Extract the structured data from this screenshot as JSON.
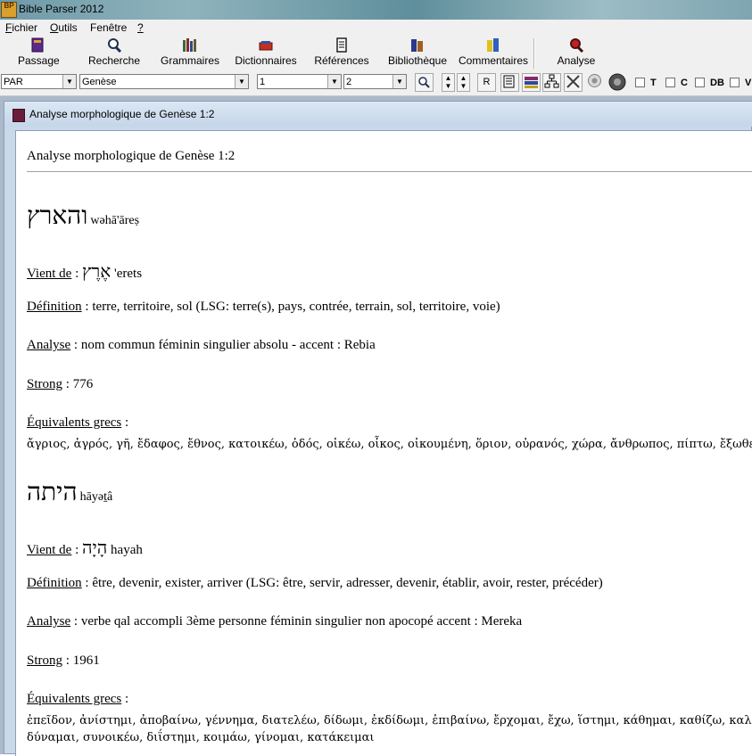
{
  "window": {
    "title": "Bible Parser 2012",
    "app_badge": "BP"
  },
  "menu": [
    {
      "label": "Fichier",
      "accel": "F",
      "rest": "ichier"
    },
    {
      "label": "Outils",
      "accel": "O",
      "rest": "utils"
    },
    {
      "label": "Fenêtre",
      "accel": "Fen",
      "rest": "être",
      "accel_pos": "n"
    },
    {
      "label": "?",
      "accel": "?",
      "rest": ""
    }
  ],
  "toolbar": {
    "buttons": [
      {
        "label": "Passage",
        "icon": "book-icon"
      },
      {
        "label": "Recherche",
        "icon": "magnifier-icon"
      },
      {
        "label": "Grammaires",
        "icon": "books-icon"
      },
      {
        "label": "Dictionnaires",
        "icon": "dictionary-icon"
      },
      {
        "label": "Références",
        "icon": "document-icon"
      },
      {
        "label": "Bibliothèque",
        "icon": "library-icon"
      },
      {
        "label": "Commentaires",
        "icon": "comments-icon"
      },
      {
        "label": "Analyse",
        "icon": "analysis-icon"
      }
    ]
  },
  "selectors": {
    "version": "PAR",
    "book": "Genèse",
    "chapter": "1",
    "verse": "2",
    "r_button": "R",
    "checkboxes": [
      "T",
      "C",
      "DB",
      "V"
    ]
  },
  "child_window": {
    "title": "Analyse morphologique de Genèse 1:2"
  },
  "content": {
    "heading": "Analyse morphologique de Genèse 1:2",
    "labels": {
      "vient_de": "Vient de",
      "definition": "Définition",
      "analyse": "Analyse",
      "strong": "Strong",
      "equivalents": "Équivalents grecs"
    },
    "entries": [
      {
        "word": "והארץ",
        "translit": "wəhā'āreṣ",
        "root_hebrew": "אֶרֶץ",
        "root_translit": "'erets",
        "definition": "terre, territoire, sol (LSG: terre(s), pays, contrée, terrain, sol, territoire, voie)",
        "analyse": "nom commun féminin singulier absolu - accent : Rebia",
        "strong": "776",
        "greek": "ἄγριος, ἀγρός, γῆ, ἔδαφος, ἔθνος, κατοικέω, ὁδός, οἰκέω, οἶκος, οἰκουμένη, ὅριον, οὐρανός, χώρα, ἄνθρωπος, πίπτω, ἔξωθεν"
      },
      {
        "word": "היתה",
        "translit": "hāyəṯâ",
        "root_hebrew": "הָיָה",
        "root_translit": "hayah",
        "definition": "être, devenir, exister, arriver (LSG: être, servir, adresser, devenir, établir, avoir, rester, précéder)",
        "analyse": "verbe qal accompli 3ème personne féminin singulier non apocopé accent : Mereka",
        "strong": "1961",
        "greek": "ἐπεῖδον, ἀνίστημι, ἀποβαίνω, γέννημα, διατελέω, δίδωμι, ἐκδίδωμι, ἐπιβαίνω, ἔρχομαι, ἔχω, ἵστημι, κάθημαι, καθίζω, καλέω, καταλ",
        "greek2": "δύναμαι, συνοικέω, διΐστημι, κοιμάω, γίνομαι, κατάκειμαι"
      }
    ]
  }
}
